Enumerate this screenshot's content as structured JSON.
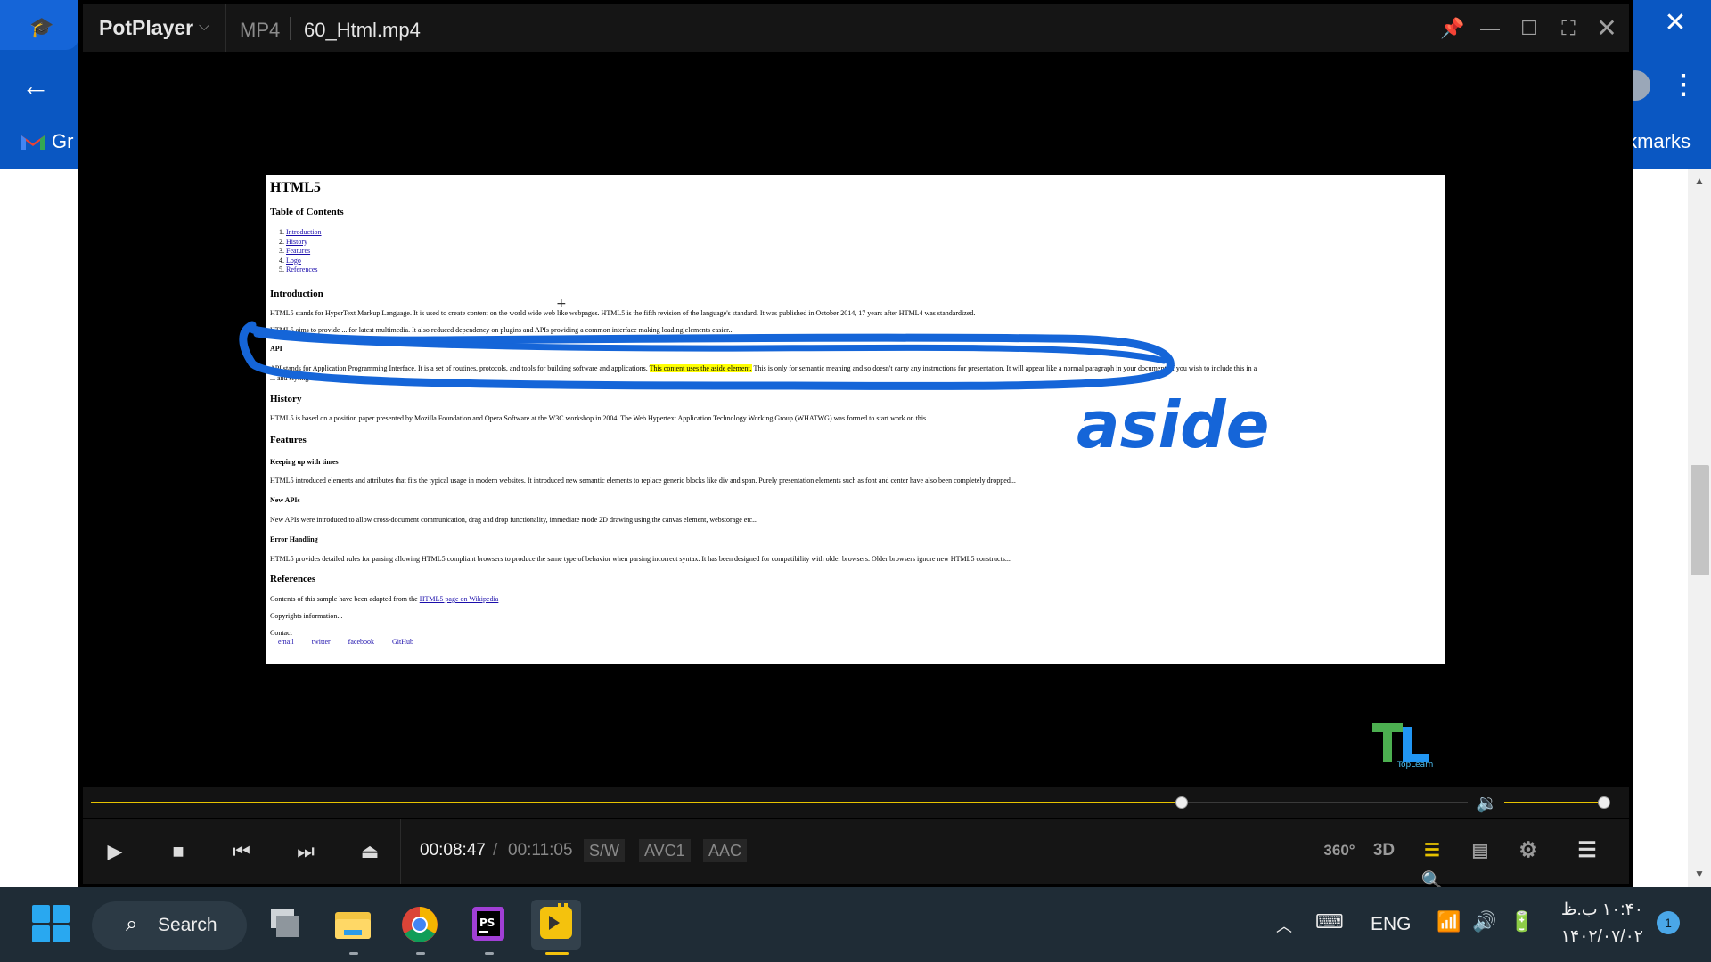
{
  "browser": {
    "bookmark_gmail": "Gr",
    "bookmarks_label": "kmarks"
  },
  "player": {
    "app_name": "PotPlayer",
    "format": "MP4",
    "filename": "60_Html.mp4",
    "time_current": "00:08:47",
    "time_separator": "/",
    "time_total": "00:11:05",
    "progress_fraction": 0.792,
    "volume_fraction": 1.0,
    "tags": {
      "sw": "S/W",
      "codec": "AVC1",
      "audio": "AAC"
    },
    "right_controls": {
      "vr": "360°",
      "three_d": "3D"
    },
    "accent_color": "#e6c200"
  },
  "video_page": {
    "title": "HTML5",
    "toc_heading": "Table of Contents",
    "toc": [
      "Introduction",
      "History",
      "Features",
      "Logo",
      "References"
    ],
    "introduction_heading": "Introduction",
    "intro_p1": "HTML5 stands for HyperText Markup Language. It is used to create content on the world wide web like webpages. HTML5 is the fifth revision of the language's standard. It was published in October 2014, 17 years after HTML4 was standardized.",
    "intro_p2": "HTML5 aims to provide ... for latest multimedia. It also reduced dependency on plugins and APIs providing a common interface making loading elements easier...",
    "api_heading": "API",
    "api_p_before": "API stands for Application Programming Interface. It is a set of routines, protocols, and tools for building software and applications. ",
    "api_p_highlight": "This content uses the aside element.",
    "api_p_after": " This is only for semantic meaning and so doesn't carry any instructions for presentation. It will appear like a normal paragraph in your document. If you wish to include this in a",
    "api_p_cont": "... and styling for it...",
    "history_heading": "History",
    "history_p": "HTML5 is based on a position paper presented by Mozilla Foundation and Opera Software at the W3C workshop in 2004. The Web Hypertext Application Technology Working Group (WHATWG) was formed to start work on this...",
    "features_heading": "Features",
    "keeping_heading": "Keeping up with times",
    "keeping_p": "HTML5 introduced elements and attributes that fits the typical usage in modern websites. It introduced new semantic elements to replace generic blocks like div and span. Purely presentation elements such as font and center have also been completely dropped...",
    "newapis_heading": "New APIs",
    "newapis_p": "New APIs were introduced to allow cross-document communication, drag and drop functionality, immediate mode 2D drawing using the canvas element, webstorage etc...",
    "error_heading": "Error Handling",
    "error_p": "HTML5 provides detailed rules for parsing allowing HTML5 compliant browsers to produce the same type of behavior when parsing incorrect syntax. It has been designed for compatibility with older browsers. Older browsers ignore new HTML5 constructs...",
    "references_heading": "References",
    "references_p": "Contents of this sample have been adapted from the ",
    "references_link": "HTML5 page on Wikipedia",
    "copyright": "Copyrights information...",
    "contact_label": "Contact",
    "contact_links": [
      "email",
      "twitter",
      "facebook",
      "GitHub"
    ]
  },
  "annotation": {
    "text": "aside",
    "color": "#1565d8"
  },
  "watermark": {
    "text": "TopLearn"
  },
  "taskbar": {
    "search_label": "Search",
    "language": "ENG",
    "time": "۱۰:۴۰ ب.ظ",
    "date": "۱۴۰۲/۰۷/۰۲",
    "notification_count": "1"
  }
}
